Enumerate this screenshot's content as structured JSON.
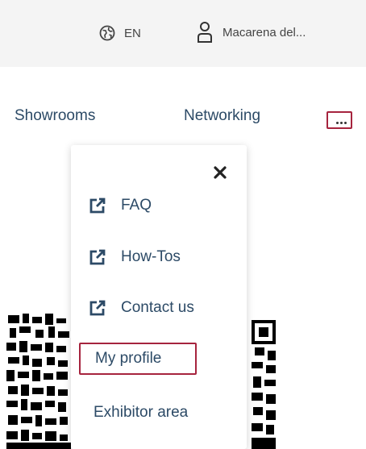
{
  "header": {
    "language_label": "EN",
    "user_name": "Macarena del..."
  },
  "nav": {
    "items": [
      {
        "label": "Showrooms"
      },
      {
        "label": "Networking"
      }
    ],
    "more_label": "..."
  },
  "dropdown": {
    "close_icon": "close-icon",
    "external_items": [
      {
        "label": "FAQ",
        "icon": "external-link-icon"
      },
      {
        "label": "How-Tos",
        "icon": "external-link-icon"
      },
      {
        "label": "Contact us",
        "icon": "external-link-icon"
      }
    ],
    "profile_label": "My profile",
    "exhibitor_label": "Exhibitor area"
  },
  "colors": {
    "nav_text": "#2c4a66",
    "focus_outline": "#a6243e",
    "topbar_bg": "#f4f4f4"
  }
}
